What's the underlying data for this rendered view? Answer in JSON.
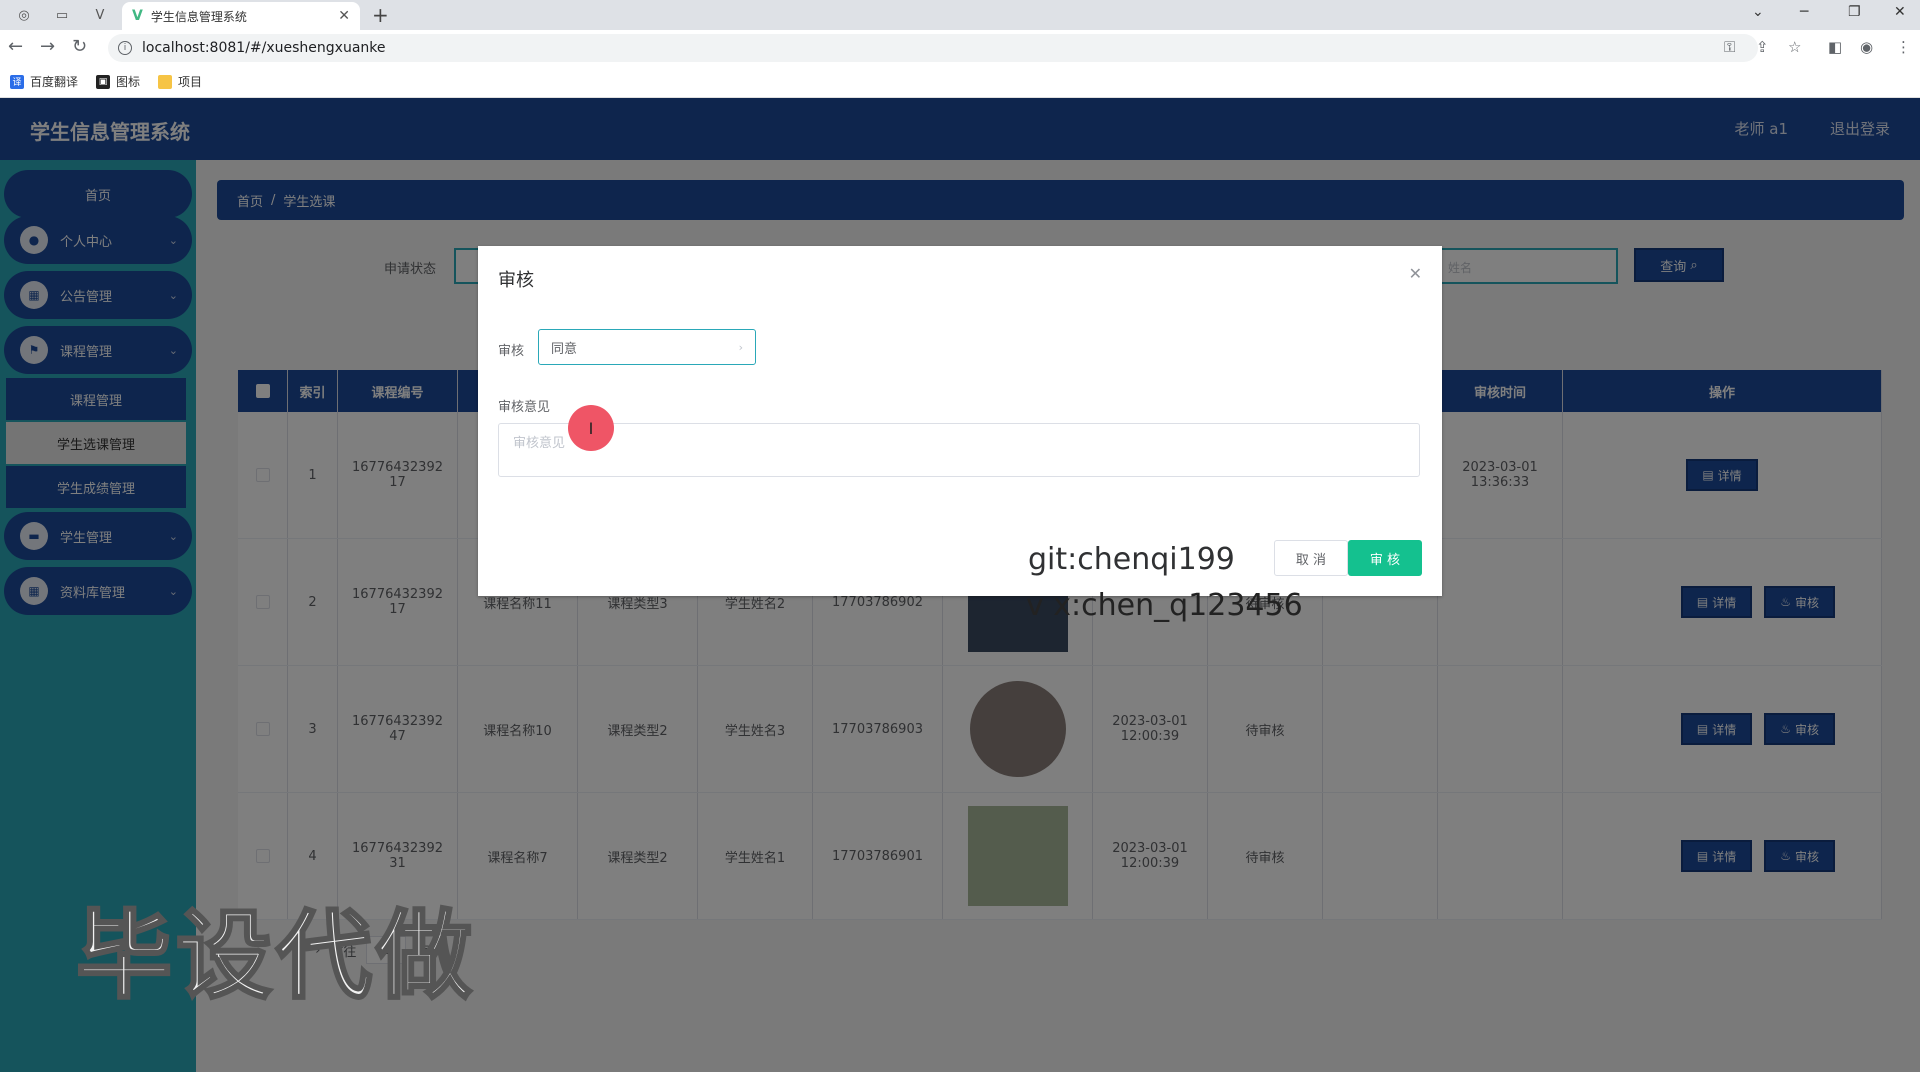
{
  "browser": {
    "tab_title": "学生信息管理系统",
    "url": "localhost:8081/#/xueshengxuanke",
    "bookmarks": [
      "百度翻译",
      "图标",
      "项目"
    ]
  },
  "app": {
    "title": "学生信息管理系统",
    "user": "老师 a1",
    "logout": "退出登录"
  },
  "sidebar": {
    "home": "首页",
    "personal": "个人中心",
    "notice": "公告管理",
    "course": "课程管理",
    "sub_course": "课程管理",
    "sub_selection": "学生选课管理",
    "sub_score": "学生成绩管理",
    "student": "学生管理",
    "library": "资料库管理"
  },
  "breadcrumb": {
    "home": "首页",
    "sep": "/",
    "current": "学生选课"
  },
  "search": {
    "status_label": "申请状态",
    "name_placeholder": "姓名",
    "query_label": "查询"
  },
  "table": {
    "headers": {
      "index": "索引",
      "course_no": "课程编号",
      "audit_time": "审核时间",
      "ops": "操作"
    },
    "rows": [
      {
        "idx": "1",
        "no": "1677643239217",
        "name": "",
        "type": "",
        "student": "",
        "phone": "",
        "time": "",
        "status": "",
        "audit_time": "2023-03-01 13:36:33"
      },
      {
        "idx": "2",
        "no": "1677643239217",
        "name": "课程名称11",
        "type": "课程类型3",
        "student": "学生姓名2",
        "phone": "17703786902",
        "time": "",
        "status": "待审核",
        "audit_time": ""
      },
      {
        "idx": "3",
        "no": "1677643239247",
        "name": "课程名称10",
        "type": "课程类型2",
        "student": "学生姓名3",
        "phone": "17703786903",
        "time": "2023-03-01 12:00:39",
        "status": "待审核",
        "audit_time": ""
      },
      {
        "idx": "4",
        "no": "1677643239231",
        "name": "课程名称7",
        "type": "课程类型2",
        "student": "学生姓名1",
        "phone": "17703786901",
        "time": "2023-03-01 12:00:39",
        "status": "待审核",
        "audit_time": ""
      }
    ],
    "detail_label": "详情",
    "audit_label": "审核"
  },
  "pager": {
    "goto": "前往",
    "page": "1",
    "page_unit": "页"
  },
  "dialog": {
    "title": "审核",
    "field_label": "审核",
    "select_value": "同意",
    "opinion_label": "审核意见",
    "opinion_placeholder": "审核意见",
    "cancel": "取 消",
    "confirm": "审 核"
  },
  "watermarks": {
    "git": "git:chenqi199",
    "vx": "v x:chen_q123456",
    "big": "毕设代做"
  },
  "colors": {
    "primary": "#1d4b9a",
    "sidebar": "#2aa8b8",
    "confirm": "#14c18f"
  }
}
